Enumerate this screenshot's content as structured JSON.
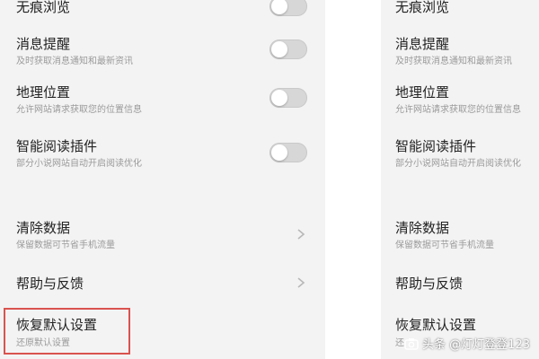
{
  "left_panel": {
    "items": [
      {
        "title": "无痕浏览",
        "subtitle": ""
      },
      {
        "title": "消息提醒",
        "subtitle": "及时获取消息通知和最新资讯"
      },
      {
        "title": "地理位置",
        "subtitle": "允许网站请求获取您的位置信息"
      },
      {
        "title": "智能阅读插件",
        "subtitle": "部分小说网站自动开启阅读优化"
      },
      {
        "title": "清除数据",
        "subtitle": "保留数据可节省手机流量"
      },
      {
        "title": "帮助与反馈",
        "subtitle": ""
      },
      {
        "title": "恢复默认设置",
        "subtitle": "还原默认设置"
      }
    ]
  },
  "right_panel": {
    "items": [
      {
        "title": "无痕浏览",
        "subtitle": ""
      },
      {
        "title": "消息提醒",
        "subtitle": "及时获取消息通知和最新资讯"
      },
      {
        "title": "地理位置",
        "subtitle": "允许网站请求获取您的位置信息"
      },
      {
        "title": "智能阅读插件",
        "subtitle": "部分小说网站自动开启阅读优化"
      },
      {
        "title": "清除数据",
        "subtitle": "保留数据可节省手机流量"
      },
      {
        "title": "帮助与反馈",
        "subtitle": ""
      },
      {
        "title": "恢复默认设置",
        "subtitle": "还"
      }
    ]
  },
  "toggles": {
    "state": "off"
  },
  "highlight_color": "#d9534f",
  "watermark": {
    "text": "头条 @灯灯登登123",
    "icon": "camera-icon"
  }
}
